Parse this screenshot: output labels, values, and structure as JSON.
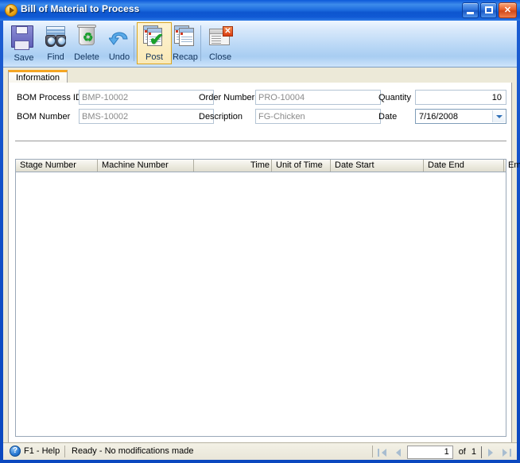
{
  "window": {
    "title": "Bill of Material to Process",
    "app_icon": "play-circle-icon",
    "controls": {
      "minimize": "minimize-button",
      "maximize": "maximize-button",
      "close": "close-button"
    }
  },
  "toolbar": {
    "items": [
      {
        "label": "Save",
        "icon": "floppy-disk-icon",
        "active": false
      },
      {
        "label": "Find",
        "icon": "binoculars-icon",
        "active": false
      },
      {
        "label": "Delete",
        "icon": "trash-recycle-icon",
        "active": false
      },
      {
        "label": "Undo",
        "icon": "undo-arrow-icon",
        "active": false
      },
      {
        "label": "Post",
        "icon": "document-check-icon",
        "active": true
      },
      {
        "label": "Recap",
        "icon": "documents-icon",
        "active": false
      },
      {
        "label": "Close",
        "icon": "window-close-icon",
        "active": false
      }
    ]
  },
  "tabs": [
    {
      "label": "Information",
      "selected": true
    }
  ],
  "form": {
    "fields": [
      {
        "label": "BOM Process ID",
        "value": "BMP-10002",
        "type": "text"
      },
      {
        "label": "BOM Number",
        "value": "BMS-10002",
        "type": "text"
      },
      {
        "label": "Order Number",
        "value": "PRO-10004",
        "type": "text"
      },
      {
        "label": "Description",
        "value": "FG-Chicken",
        "type": "text"
      },
      {
        "label": "Quantity",
        "value": "10",
        "type": "number"
      },
      {
        "label": "Date",
        "value": "7/16/2008",
        "type": "combo"
      }
    ]
  },
  "grid": {
    "columns": [
      {
        "label": "Stage Number",
        "align": "left"
      },
      {
        "label": "Machine Number",
        "align": "left"
      },
      {
        "label": "Time",
        "align": "right"
      },
      {
        "label": "Unit of Time",
        "align": "left"
      },
      {
        "label": "Date Start",
        "align": "left"
      },
      {
        "label": "Date End",
        "align": "left"
      },
      {
        "label": "Employee ID",
        "align": "left"
      }
    ],
    "rows": []
  },
  "statusbar": {
    "help_icon": "question-circle-icon",
    "help_label": "F1 - Help",
    "status_text": "Ready - No modifications made",
    "navigation": {
      "first": "first-record-icon",
      "previous": "previous-record-icon",
      "current_page": "1",
      "of_label": "of",
      "total_pages": "1",
      "next": "next-record-icon",
      "last": "last-record-icon"
    }
  },
  "colors": {
    "title_blue": "#1359d0",
    "tab_accent": "#f5a623",
    "toolbar_active": "#fae9b6",
    "client_bg": "#ece9d8"
  }
}
